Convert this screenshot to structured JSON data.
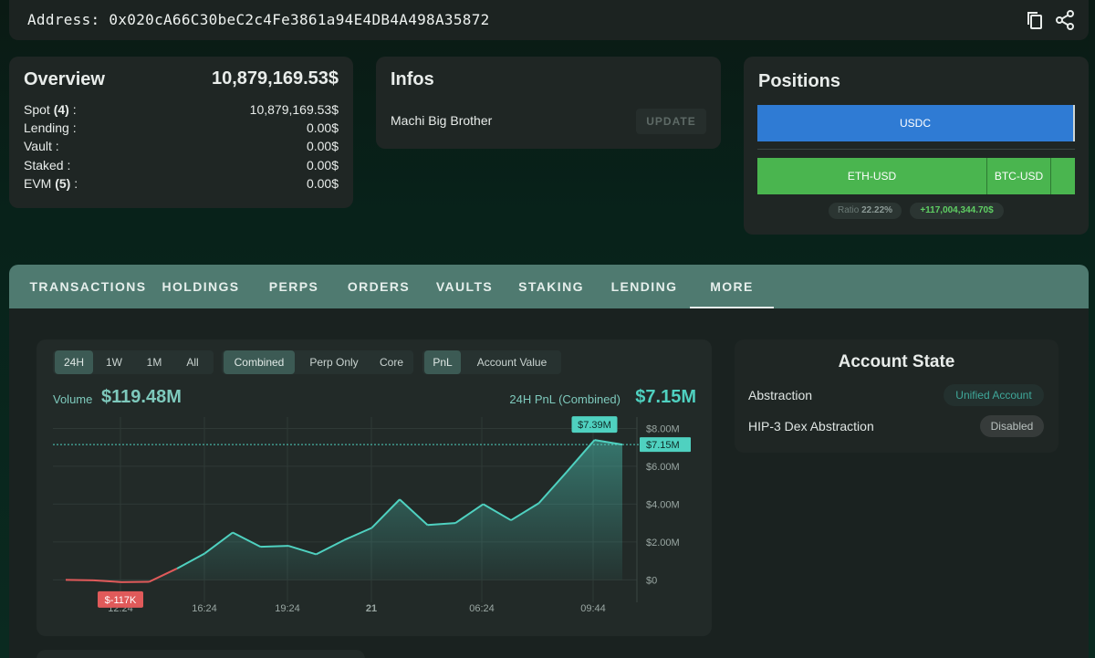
{
  "address": {
    "label": "Address:",
    "value": "0x020cA66C30beC2c4Fe3861a94E4DB4A498A35872"
  },
  "icons": {
    "copy": "copy-icon",
    "share": "share-icon"
  },
  "overview": {
    "title": "Overview",
    "total": "10,879,169.53$",
    "rows": [
      {
        "label": "Spot",
        "count": "(4)",
        "suffix": ":",
        "value": "10,879,169.53$"
      },
      {
        "label": "Lending :",
        "value": "0.00$"
      },
      {
        "label": "Vault :",
        "value": "0.00$"
      },
      {
        "label": "Staked :",
        "value": "0.00$"
      },
      {
        "label": "EVM",
        "count": "(5)",
        "suffix": ":",
        "value": "0.00$"
      }
    ]
  },
  "infos": {
    "title": "Infos",
    "name": "Machi Big Brother",
    "update_label": "UPDATE"
  },
  "positions": {
    "title": "Positions",
    "long_bar": {
      "label": "USDC",
      "color": "#2f7bd4"
    },
    "short_bars": [
      {
        "label": "ETH-USD",
        "color": "#4ab54f",
        "share": 0.72
      },
      {
        "label": "BTC-USD",
        "color": "#4ab54f",
        "share": 0.2
      },
      {
        "label": "",
        "color": "#4ab54f",
        "share": 0.08
      }
    ],
    "ratio_label": "Ratio",
    "ratio_value": "22.22%",
    "net_value": "+117,004,344.70$"
  },
  "tabs": [
    "TRANSACTIONS",
    "HOLDINGS",
    "PERPS",
    "ORDERS",
    "VAULTS",
    "STAKING",
    "LENDING",
    "MORE"
  ],
  "active_tab": "MORE",
  "chart_controls": {
    "timeframes": [
      "24H",
      "1W",
      "1M",
      "All"
    ],
    "timeframe_selected": "24H",
    "modes": [
      "Combined",
      "Perp Only",
      "Core"
    ],
    "mode_selected": "Combined",
    "metrics": [
      "PnL",
      "Account Value"
    ],
    "metric_selected": "PnL"
  },
  "volume": {
    "label": "Volume",
    "value": "$119.48M"
  },
  "pnl": {
    "label": "24H PnL (Combined)",
    "value": "$7.15M"
  },
  "chart_data": {
    "type": "area",
    "x_ticks": [
      "12:24",
      "16:24",
      "19:24",
      "21",
      "06:24",
      "09:44"
    ],
    "y_ticks": [
      "$8.00M",
      "$6.00M",
      "$4.00M",
      "$2.00M",
      "$0"
    ],
    "ylim": [
      -0.8,
      8.6
    ],
    "y_unit": "$M",
    "values": [
      0.0,
      -0.02,
      -0.117,
      -0.1,
      0.6,
      1.4,
      2.5,
      1.75,
      1.8,
      1.35,
      2.1,
      2.75,
      4.25,
      2.9,
      3.0,
      4.0,
      3.15,
      4.05,
      5.7,
      7.39,
      7.15
    ],
    "positive_color": "#4fd1c0",
    "negative_color": "#e05a5a",
    "max_label": "$7.39M",
    "min_label": "$-117K",
    "current_label": "$7.15M",
    "grid": true
  },
  "account_state": {
    "title": "Account State",
    "rows": [
      {
        "label": "Abstraction",
        "badge": "Unified Account"
      },
      {
        "label": "HIP-3 Dex Abstraction",
        "badge": "Disabled"
      }
    ]
  }
}
